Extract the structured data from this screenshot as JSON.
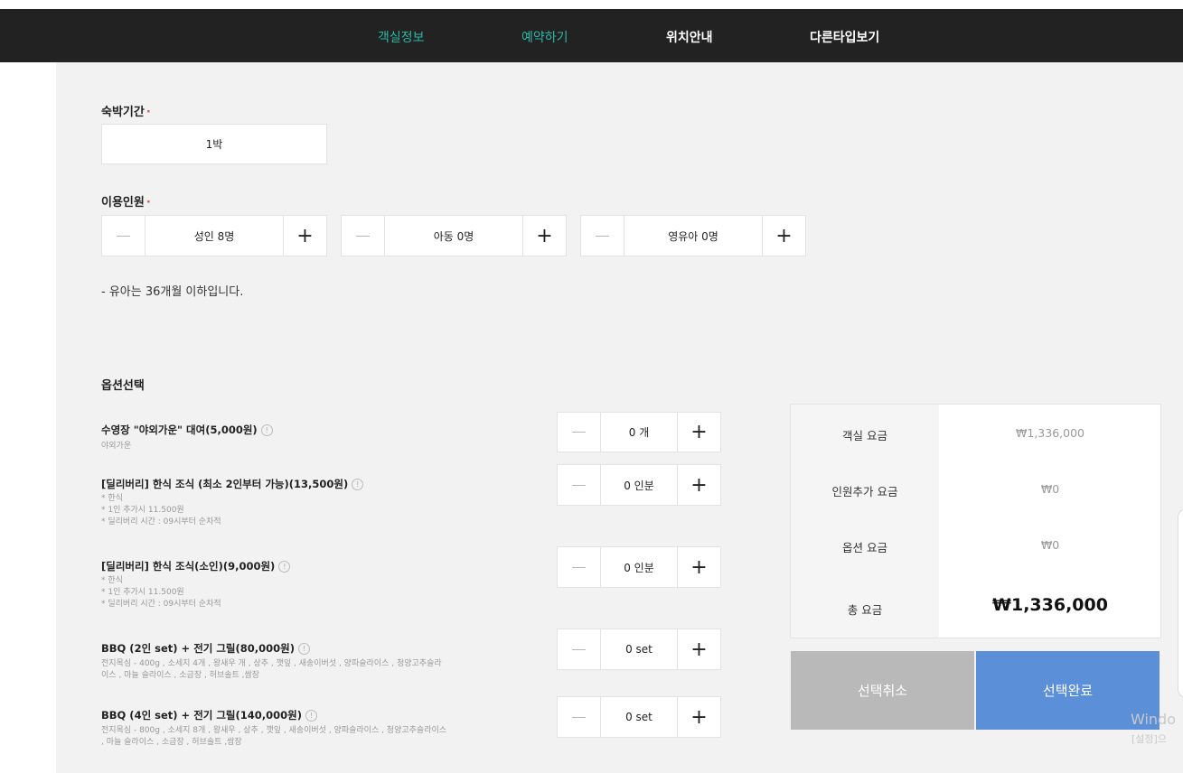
{
  "nav": {
    "tabs": [
      {
        "label": "객실정보"
      },
      {
        "label": "예약하기"
      },
      {
        "label": "위치안내"
      },
      {
        "label": "다른타입보기"
      }
    ]
  },
  "stay": {
    "label": "숙박기간",
    "required_mark": "·",
    "value": "1박"
  },
  "guests": {
    "label": "이용인원",
    "required_mark": "·",
    "adult": "성인 8명",
    "child": "아동 0명",
    "infant": "영유아 0명",
    "note": "- 유아는 36개월 이하입니다."
  },
  "options": {
    "label": "옵션선택",
    "items": [
      {
        "title": "수영장 \"야외가운\" 대여(5,000원)",
        "desc": [
          "야외가운"
        ],
        "value": "0 개"
      },
      {
        "title": "[딜리버리] 한식 조식 (최소 2인부터 가능)(13,500원)",
        "desc": [
          "* 한식",
          "* 1인 추가시 11.500원",
          "* 딜리버리 시간 : 09시부터 순차적"
        ],
        "value": "0 인분"
      },
      {
        "title": "[딜리버리] 한식 조식(소인)(9,000원)",
        "desc": [
          "* 한식",
          "* 1인 추가시 11.500원",
          "* 딜리버리 시간 : 09시부터 순차적"
        ],
        "value": "0 인분"
      },
      {
        "title": "BBQ (2인 set) + 전기 그릴(80,000원)",
        "desc": [
          "전지목심 - 400g , 소세지 4개 , 왕새우 개 , 상추 , 깻잎 , 새송이버섯 , 양파슬라이스 , 청양고추슬라",
          "이스 , 마늘 슬라이스 , 소금장 , 허브솔트 ,쌈장"
        ],
        "value": "0 set"
      },
      {
        "title": "BBQ (4인 set) + 전기 그릴(140,000원)",
        "desc": [
          "전지목심 - 800g , 소세지 8개 , 왕새우 , 상추 , 깻잎 , 새송이버섯 , 양파슬라이스 , 청양고추슬라이스",
          " , 마늘 슬라이스 , 소금장 , 허브솔트 ,쌈장"
        ],
        "value": "0 set"
      }
    ]
  },
  "pricing": {
    "room_label": "객실 요금",
    "room_value": "₩1,336,000",
    "extra_label": "인원추가 요금",
    "extra_value": "₩0",
    "option_label": "옵션 요금",
    "option_value": "₩0",
    "total_label": "총 요금",
    "total_value": "₩1,336,000"
  },
  "actions": {
    "cancel": "선택취소",
    "confirm": "선택완료"
  },
  "watermark": {
    "line1": "Windo",
    "line2": "[설정]으"
  },
  "colors": {
    "nav_bg": "#222222",
    "nav_active": "#2bb7a5",
    "confirm": "#5b8fd8",
    "cancel": "#b9b9b9",
    "required": "#e0534f"
  }
}
